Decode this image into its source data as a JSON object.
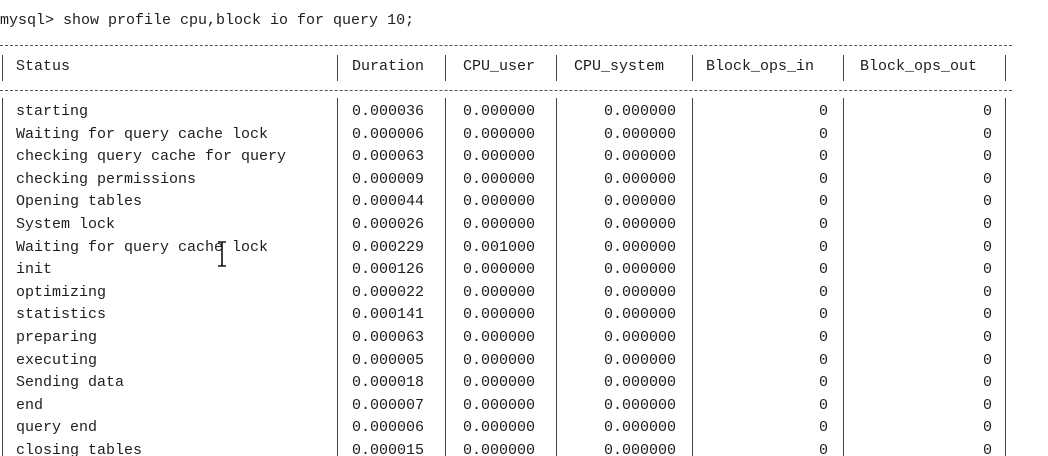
{
  "terminal": {
    "prompt": "mysql> show profile cpu,block io for query 10;",
    "columns": [
      "Status",
      "Duration",
      "CPU_user",
      "CPU_system",
      "Block_ops_in",
      "Block_ops_out"
    ],
    "rows": [
      [
        "starting",
        "0.000036",
        "0.000000",
        "0.000000",
        "0",
        "0"
      ],
      [
        "Waiting for query cache lock",
        "0.000006",
        "0.000000",
        "0.000000",
        "0",
        "0"
      ],
      [
        "checking query cache for query",
        "0.000063",
        "0.000000",
        "0.000000",
        "0",
        "0"
      ],
      [
        "checking permissions",
        "0.000009",
        "0.000000",
        "0.000000",
        "0",
        "0"
      ],
      [
        "Opening tables",
        "0.000044",
        "0.000000",
        "0.000000",
        "0",
        "0"
      ],
      [
        "System lock",
        "0.000026",
        "0.000000",
        "0.000000",
        "0",
        "0"
      ],
      [
        "Waiting for query cache lock",
        "0.000229",
        "0.001000",
        "0.000000",
        "0",
        "0"
      ],
      [
        "init",
        "0.000126",
        "0.000000",
        "0.000000",
        "0",
        "0"
      ],
      [
        "optimizing",
        "0.000022",
        "0.000000",
        "0.000000",
        "0",
        "0"
      ],
      [
        "statistics",
        "0.000141",
        "0.000000",
        "0.000000",
        "0",
        "0"
      ],
      [
        "preparing",
        "0.000063",
        "0.000000",
        "0.000000",
        "0",
        "0"
      ],
      [
        "executing",
        "0.000005",
        "0.000000",
        "0.000000",
        "0",
        "0"
      ],
      [
        "Sending data",
        "0.000018",
        "0.000000",
        "0.000000",
        "0",
        "0"
      ],
      [
        "end",
        "0.000007",
        "0.000000",
        "0.000000",
        "0",
        "0"
      ],
      [
        "query end",
        "0.000006",
        "0.000000",
        "0.000000",
        "0",
        "0"
      ],
      [
        "closing tables",
        "0.000015",
        "0.000000",
        "0.000000",
        "0",
        "0"
      ]
    ],
    "cursor": "text-cursor-icon"
  },
  "colors": {
    "background": "#ffffff",
    "text": "#1e1e1e",
    "border": "#444444"
  }
}
